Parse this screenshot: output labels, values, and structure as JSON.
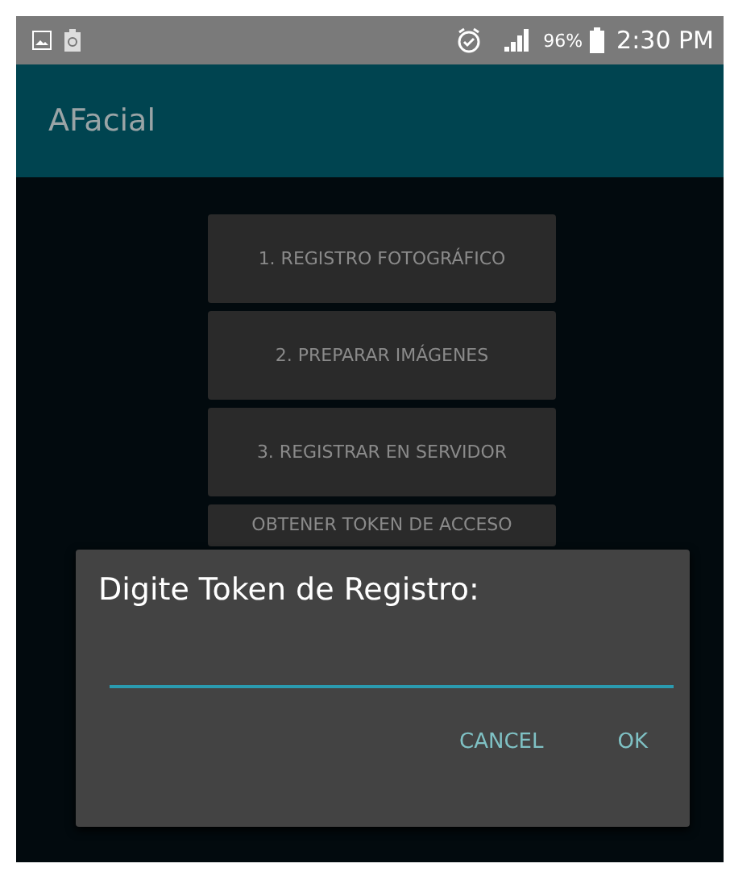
{
  "status_bar": {
    "battery_percent": "96%",
    "time": "2:30 PM"
  },
  "app_bar": {
    "title": "AFacial"
  },
  "buttons": [
    {
      "label": "1. REGISTRO FOTOGRÁFICO"
    },
    {
      "label": "2. PREPARAR IMÁGENES"
    },
    {
      "label": "3. REGISTRAR EN SERVIDOR"
    },
    {
      "label": "OBTENER TOKEN DE ACCESO"
    }
  ],
  "dialog": {
    "title": "Digite Token de Registro:",
    "actions": [
      "CANCEL",
      "OK"
    ]
  }
}
